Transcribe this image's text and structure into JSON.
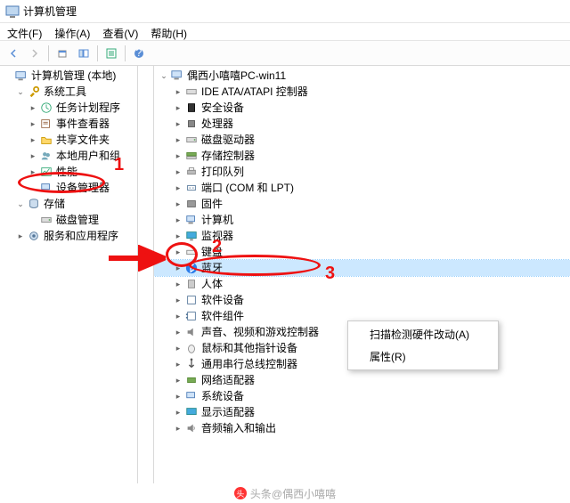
{
  "window": {
    "title": "计算机管理"
  },
  "menu": {
    "file": "文件(F)",
    "action": "操作(A)",
    "view": "查看(V)",
    "help": "帮助(H)"
  },
  "left_tree": {
    "root": "计算机管理 (本地)",
    "system_tools": "系统工具",
    "task_scheduler": "任务计划程序",
    "event_viewer": "事件查看器",
    "shared_folders": "共享文件夹",
    "local_users": "本地用户和组",
    "performance": "性能",
    "device_manager": "设备管理器",
    "storage": "存储",
    "disk_mgmt": "磁盘管理",
    "services_apps": "服务和应用程序"
  },
  "right_tree": {
    "host": "偶西小嘻嘻PC-win11",
    "ide": "IDE ATA/ATAPI 控制器",
    "security": "安全设备",
    "cpu": "处理器",
    "disk_drive": "磁盘驱动器",
    "storage_ctrl": "存储控制器",
    "print_queue": "打印队列",
    "ports": "端口 (COM 和 LPT)",
    "firmware": "固件",
    "computer": "计算机",
    "monitor": "监视器",
    "keyboard": "键盘",
    "bluetooth": "蓝牙",
    "hid": "人体",
    "software_dev": "软件设备",
    "software_comp": "软件组件",
    "sound": "声音、视频和游戏控制器",
    "mouse": "鼠标和其他指针设备",
    "usb": "通用串行总线控制器",
    "network": "网络适配器",
    "system_dev": "系统设备",
    "display": "显示适配器",
    "audio": "音频输入和输出"
  },
  "context_menu": {
    "scan": "扫描检测硬件改动(A)",
    "properties": "属性(R)"
  },
  "annotations": {
    "a1": "1",
    "a2": "2",
    "a3": "3"
  },
  "footer": {
    "text": "头条@偶西小嘻嘻"
  }
}
